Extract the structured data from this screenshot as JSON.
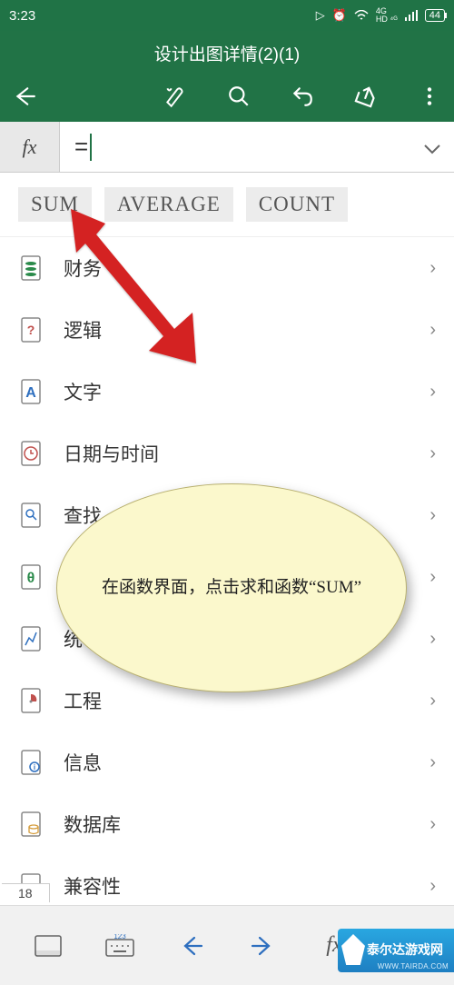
{
  "status": {
    "time": "3:23",
    "battery": "44"
  },
  "title": "设计出图详情(2)(1)",
  "formula": {
    "fx": "fx",
    "value": "="
  },
  "suggestions": [
    "SUM",
    "AVERAGE",
    "COUNT"
  ],
  "categories": [
    {
      "label": "财务",
      "icon": "finance"
    },
    {
      "label": "逻辑",
      "icon": "logic"
    },
    {
      "label": "文字",
      "icon": "text"
    },
    {
      "label": "日期与时间",
      "icon": "datetime"
    },
    {
      "label": "查找",
      "icon": "lookup"
    },
    {
      "label": "",
      "icon": "math"
    },
    {
      "label": "统",
      "icon": "stats"
    },
    {
      "label": "工程",
      "icon": "engineering"
    },
    {
      "label": "信息",
      "icon": "info"
    },
    {
      "label": "数据库",
      "icon": "database"
    },
    {
      "label": "兼容性",
      "icon": "compat"
    }
  ],
  "sheet_tab": "18",
  "callout": "在函数界面，点击求和函数“SUM”",
  "watermark": {
    "brand": "泰尔达游戏网",
    "url": "WWW.TAIRDA.COM"
  }
}
